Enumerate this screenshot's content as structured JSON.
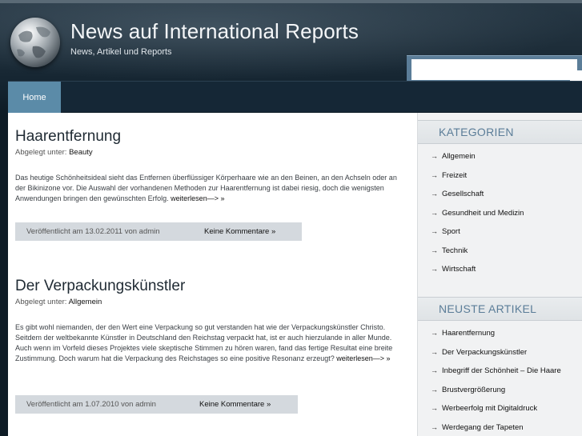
{
  "header": {
    "site_title": "News auf International Reports",
    "tagline": "News, Artikel und Reports",
    "search": {
      "value": "",
      "placeholder": ""
    }
  },
  "nav": {
    "items": [
      {
        "label": "Home"
      }
    ]
  },
  "posts": [
    {
      "title": "Haarentfernung",
      "filed_under_label": "Abgelegt unter:",
      "category": "Beauty",
      "excerpt": "Das heutige Schönheitsideal sieht das Entfernen überflüssiger Körperhaare wie an den Beinen, an den Achseln oder an der Bikinizone vor. Die Auswahl der vorhandenen Methoden zur Haarentfernung ist dabei riesig, doch die wenigsten Anwendungen bringen den gewünschten Erfolg.",
      "read_more": "weiterlesen—> »",
      "published": "Veröffentlicht am 13.02.2011 von admin",
      "comments": "Keine Kommentare »"
    },
    {
      "title": "Der Verpackungskünstler",
      "filed_under_label": "Abgelegt unter:",
      "category": "Allgemein",
      "excerpt": "Es gibt wohl niemanden, der den Wert eine Verpackung so gut verstanden hat wie der Verpackungskünstler Christo. Seitdem der weltbekannte Künstler in Deutschland den Reichstag verpackt hat, ist er auch hierzulande in aller Munde. Auch wenn im Vorfeld dieses Projektes viele skeptische Stimmen zu hören waren, fand das fertige Resultat eine breite Zustimmung. Doch warum hat die Verpackung des Reichstages so eine positive Resonanz erzeugt?",
      "read_more": "weiterlesen—> »",
      "published": "Veröffentlicht am 1.07.2010 von admin",
      "comments": "Keine Kommentare »"
    }
  ],
  "sidebar": {
    "categories": {
      "title": "KATEGORIEN",
      "items": [
        "Allgemein",
        "Freizeit",
        "Gesellschaft",
        "Gesundheit und Medizin",
        "Sport",
        "Technik",
        "Wirtschaft"
      ]
    },
    "recent": {
      "title": "NEUSTE ARTIKEL",
      "items": [
        "Haarentfernung",
        "Der Verpackungskünstler",
        "Inbegriff der Schönheit – Die Haare",
        "Brustvergrößerung",
        "Werbeerfolg mit Digitaldruck",
        "Werdegang der Tapeten"
      ]
    },
    "bullet": "→"
  }
}
